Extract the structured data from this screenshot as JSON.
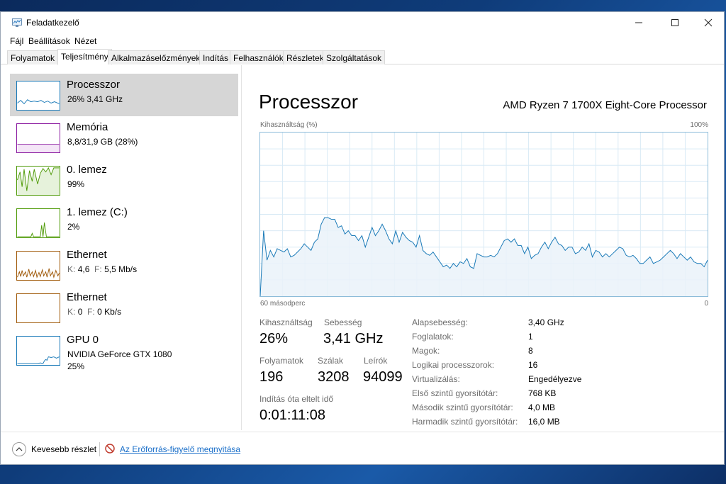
{
  "window": {
    "title": "Feladatkezelő",
    "controls": {
      "minimize": "minimize-icon",
      "maximize": "maximize-icon",
      "close": "close-icon"
    }
  },
  "menu": [
    "Fájl",
    "Beállítások",
    "Nézet"
  ],
  "tabs": [
    {
      "label": "Folyamatok"
    },
    {
      "label": "Teljesítmény",
      "active": true
    },
    {
      "label": "Alkalmazáselőzmények"
    },
    {
      "label": "Indítás"
    },
    {
      "label": "Felhasználók"
    },
    {
      "label": "Részletek"
    },
    {
      "label": "Szolgáltatások"
    }
  ],
  "resources": [
    {
      "name": "Processzor",
      "sub": "26% 3,41 GHz",
      "color": "#1a7ab8",
      "selected": true
    },
    {
      "name": "Memória",
      "sub": "8,8/31,9 GB (28%)",
      "color": "#8a1aa0"
    },
    {
      "name": "0. lemez",
      "sub": "99%",
      "color": "#4e9a06"
    },
    {
      "name": "1. lemez (C:)",
      "sub": "2%",
      "color": "#4e9a06"
    },
    {
      "name": "Ethernet",
      "sub_k": "K:",
      "sub_k_val": "4,6",
      "sub_f": "F:",
      "sub_f_val": "5,5 Mb/s",
      "color": "#a05a0a"
    },
    {
      "name": "Ethernet",
      "sub_k": "K:",
      "sub_k_val": "0",
      "sub_f": "F:",
      "sub_f_val": "0 Kb/s",
      "color": "#a05a0a"
    },
    {
      "name": "GPU 0",
      "sub": "NVIDIA GeForce GTX 1080",
      "sub2": "25%",
      "color": "#1a7ab8"
    }
  ],
  "detail": {
    "title": "Processzor",
    "model": "AMD Ryzen 7 1700X Eight-Core Processor",
    "graph": {
      "y_label": "Kihasználtság (%)",
      "y_max_label": "100%",
      "x_left_label": "60 másodperc",
      "x_right_label": "0",
      "line_color": "#1a7ab8",
      "fill_color": "#eaf2f9",
      "grid_color": "#d9eaf5",
      "values": [
        0,
        40,
        22,
        28,
        24,
        29,
        28,
        27,
        29,
        24,
        25,
        27,
        29,
        32,
        30,
        28,
        33,
        35,
        44,
        48,
        48,
        47,
        47,
        42,
        43,
        38,
        40,
        37,
        37,
        34,
        37,
        30,
        36,
        42,
        37,
        40,
        44,
        40,
        35,
        32,
        40,
        33,
        39,
        36,
        34,
        33,
        30,
        37,
        28,
        26,
        25,
        27,
        24,
        21,
        18,
        19,
        17,
        20,
        18,
        21,
        20,
        23,
        18,
        17,
        26,
        25,
        24,
        24,
        25,
        24,
        26,
        30,
        34,
        35,
        33,
        35,
        31,
        31,
        26,
        30,
        23,
        25,
        26,
        30,
        33,
        29,
        33,
        36,
        32,
        31,
        28,
        30,
        30,
        26,
        27,
        30,
        28,
        32,
        24,
        28,
        27,
        24,
        26,
        24,
        26,
        28,
        30,
        29,
        25,
        24,
        25,
        23,
        20,
        20,
        22,
        24,
        20,
        21,
        22,
        24,
        26,
        28,
        26,
        23,
        26,
        24,
        22,
        24,
        21,
        20,
        20,
        18,
        22
      ]
    },
    "stats": {
      "utilization_label": "Kihasználtság",
      "utilization": "26%",
      "speed_label": "Sebesség",
      "speed": "3,41 GHz",
      "processes_label": "Folyamatok",
      "processes": "196",
      "threads_label": "Szálak",
      "threads": "3208",
      "handles_label": "Leírók",
      "handles": "94099",
      "uptime_label": "Indítás óta eltelt idő",
      "uptime": "0:01:11:08"
    },
    "info": [
      {
        "key": "Alapsebesség:",
        "value": "3,40 GHz"
      },
      {
        "key": "Foglalatok:",
        "value": "1"
      },
      {
        "key": "Magok:",
        "value": "8"
      },
      {
        "key": "Logikai processzorok:",
        "value": "16"
      },
      {
        "key": "Virtualizálás:",
        "value": "Engedélyezve"
      },
      {
        "key": "Első szintű gyorsítótár:",
        "value": "768 KB"
      },
      {
        "key": "Második szintű gyorsítótár:",
        "value": "4,0 MB"
      },
      {
        "key": "Harmadik szintű gyorsítótár:",
        "value": "16,0 MB"
      }
    ]
  },
  "footer": {
    "fewer_details": "Kevesebb részlet",
    "open_resmon": "Az Erőforrás-figyelő megnyitása"
  }
}
